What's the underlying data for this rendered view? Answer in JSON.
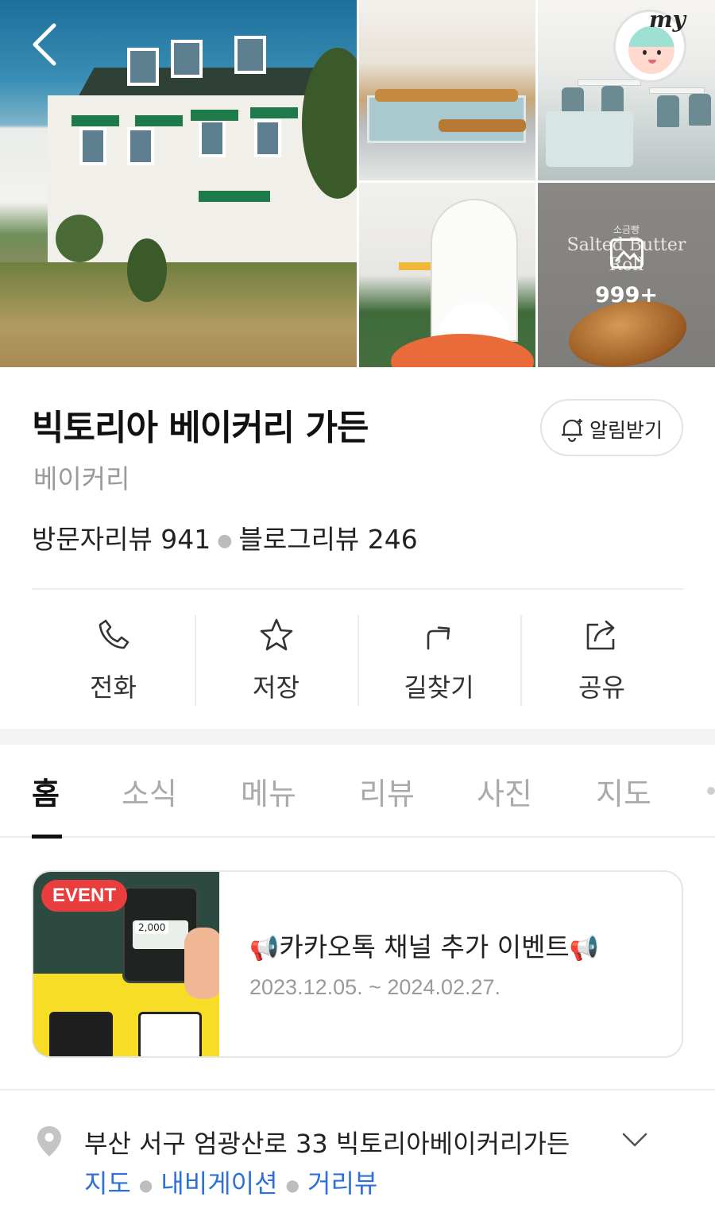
{
  "gallery": {
    "menu_photo": {
      "korean": "소금빵",
      "title": "Salted Butter Roll"
    },
    "photo_count": "999+",
    "my_label": "my"
  },
  "place": {
    "name": "빅토리아 베이커리 가든",
    "category": "베이커리",
    "notify_label": "알림받기",
    "visitor_review_label": "방문자리뷰 941",
    "blog_review_label": "블로그리뷰 246"
  },
  "actions": [
    {
      "label": "전화",
      "icon": "phone-icon"
    },
    {
      "label": "저장",
      "icon": "star-icon"
    },
    {
      "label": "길찾기",
      "icon": "directions-icon"
    },
    {
      "label": "공유",
      "icon": "share-icon"
    }
  ],
  "tabs": [
    {
      "label": "홈",
      "active": true
    },
    {
      "label": "소식",
      "active": false
    },
    {
      "label": "메뉴",
      "active": false
    },
    {
      "label": "리뷰",
      "active": false
    },
    {
      "label": "사진",
      "active": false
    },
    {
      "label": "지도",
      "active": false
    }
  ],
  "event": {
    "badge": "EVENT",
    "thumb_price": "2,000",
    "title": "카카오톡 채널 추가 이벤트",
    "date_range": "2023.12.05. ~ 2024.02.27."
  },
  "address": {
    "text": "부산 서구 엄광산로 33 빅토리아베이커리가든",
    "links": [
      "지도",
      "내비게이션",
      "거리뷰"
    ]
  },
  "colors": {
    "link": "#2f6fd8",
    "event_badge": "#ea3d3d",
    "active_tab": "#111111"
  }
}
